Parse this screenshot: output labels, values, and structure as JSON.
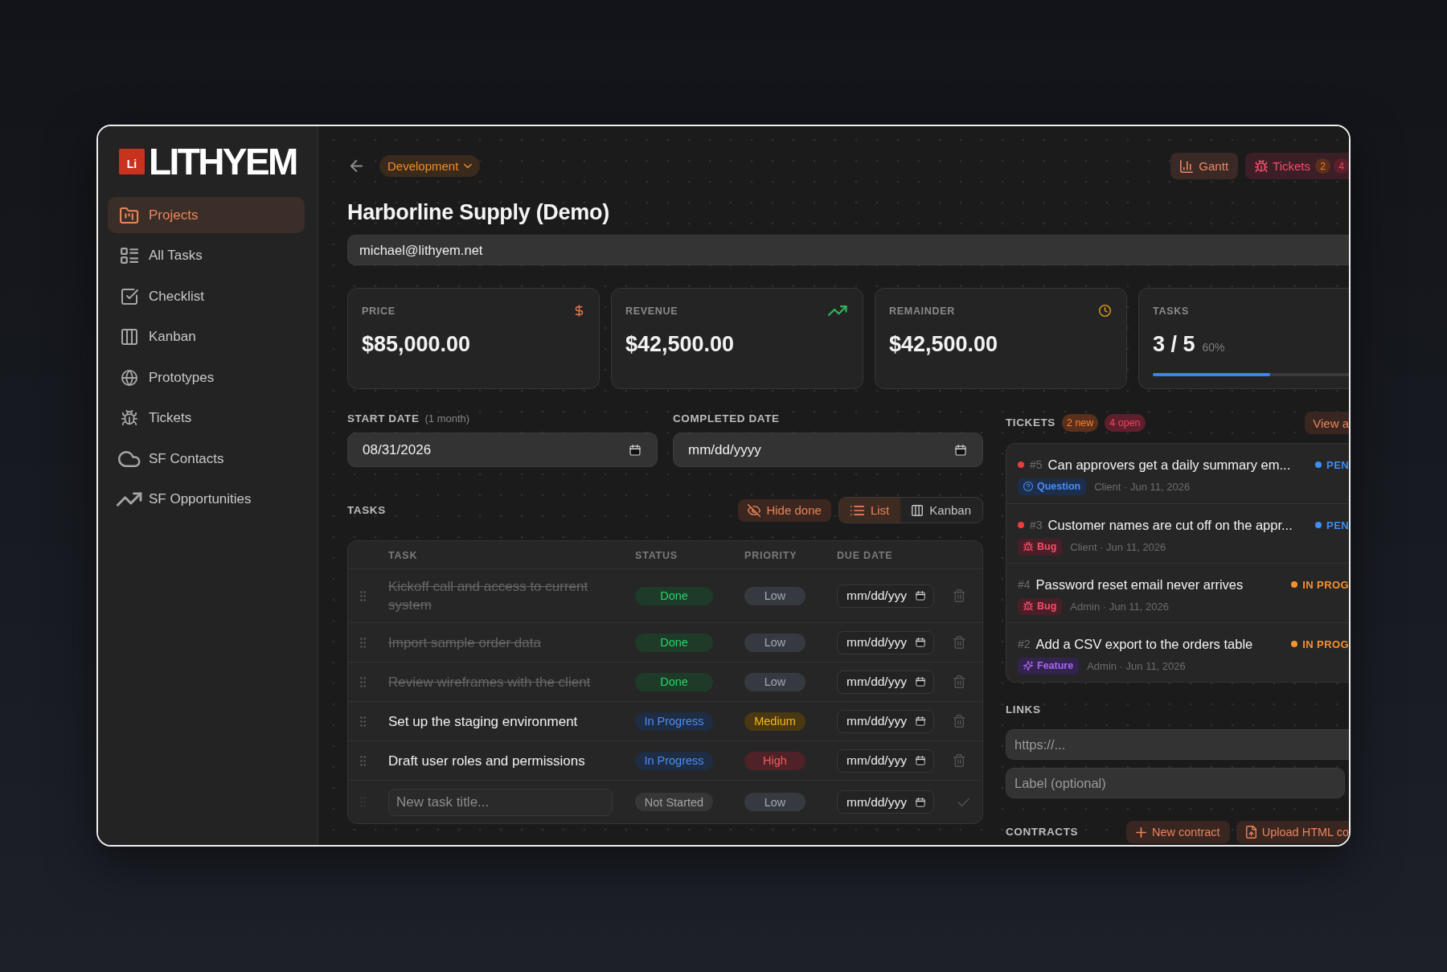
{
  "sidebar": {
    "logo": {
      "mark": "Li",
      "name": "LITHYEM"
    },
    "items": [
      {
        "label": "Projects",
        "selected": true
      },
      {
        "label": "All Tasks",
        "selected": false
      },
      {
        "label": "Checklist",
        "selected": false
      },
      {
        "label": "Kanban",
        "selected": false
      },
      {
        "label": "Prototypes",
        "selected": false
      },
      {
        "label": "Tickets",
        "selected": false
      },
      {
        "label": "SF Contacts",
        "selected": false
      },
      {
        "label": "SF Opportunities",
        "selected": false
      }
    ]
  },
  "header": {
    "stage": "Development",
    "buttons": [
      {
        "kind": "gantt",
        "label": "Gantt"
      },
      {
        "kind": "tickets",
        "label": "Tickets",
        "badges": [
          {
            "text": "2",
            "kind": "new"
          },
          {
            "text": "4",
            "kind": "open"
          }
        ]
      }
    ]
  },
  "project": {
    "title": "Harborline Supply (Demo)",
    "email": {
      "value": "michael@lithyem.net"
    }
  },
  "stats": [
    {
      "kind": "amount",
      "label": "PRICE",
      "value": "$85,000.00"
    },
    {
      "kind": "amount",
      "label": "REVENUE",
      "value": "$42,500.00"
    },
    {
      "kind": "amount",
      "label": "REMAINDER",
      "value": "$42,500.00"
    },
    {
      "kind": "progress",
      "label": "TASKS",
      "value": "3 / 5",
      "note": "60%",
      "level": 0.6
    }
  ],
  "dates": [
    {
      "label": "START DATE",
      "note": "(1 month)",
      "value": "08/31/2026"
    },
    {
      "label": "COMPLETED DATE",
      "placeholder": "mm/dd/yyyy"
    }
  ],
  "tasks": {
    "title": "TASKS",
    "hide_done": "Hide done",
    "views": [
      {
        "label": "List",
        "selected": true
      },
      {
        "label": "Kanban",
        "selected": false
      }
    ],
    "columns": [
      "TASK",
      "STATUS",
      "PRIORITY",
      "DUE DATE"
    ],
    "rows": [
      {
        "title": "Kickoff call and access to current system",
        "done": true,
        "status": {
          "label": "Done",
          "kind": "done"
        },
        "priority": {
          "label": "Low",
          "kind": "low"
        },
        "due_placeholder": "mm/dd/yyy"
      },
      {
        "title": "Import sample order data",
        "done": true,
        "status": {
          "label": "Done",
          "kind": "done"
        },
        "priority": {
          "label": "Low",
          "kind": "low"
        },
        "due_placeholder": "mm/dd/yyy"
      },
      {
        "title": "Review wireframes with the client",
        "done": true,
        "status": {
          "label": "Done",
          "kind": "done"
        },
        "priority": {
          "label": "Low",
          "kind": "low"
        },
        "due_placeholder": "mm/dd/yyy"
      },
      {
        "title": "Set up the staging environment",
        "done": false,
        "status": {
          "label": "In Progress",
          "kind": "in_progress"
        },
        "priority": {
          "label": "Medium",
          "kind": "medium"
        },
        "due_placeholder": "mm/dd/yyy"
      },
      {
        "title": "Draft user roles and permissions",
        "done": false,
        "status": {
          "label": "In Progress",
          "kind": "in_progress"
        },
        "priority": {
          "label": "High",
          "kind": "high"
        },
        "due_placeholder": "mm/dd/yyy"
      }
    ],
    "new_task": {
      "placeholder": "New task title...",
      "status": {
        "label": "Not Started",
        "kind": "not_started"
      },
      "priority": {
        "label": "Low",
        "kind": "low"
      },
      "due_placeholder": "mm/dd/yyy"
    }
  },
  "tickets": {
    "title": "TICKETS",
    "badges": [
      {
        "text": "2 new",
        "kind": "new"
      },
      {
        "text": "4 open",
        "kind": "open"
      }
    ],
    "view_all": "View a",
    "items": [
      {
        "new": true,
        "number": "#5",
        "title": "Can approvers get a daily summary em...",
        "status": {
          "label": "PEN",
          "color": "#3f8ef2"
        },
        "type": {
          "kind": "question",
          "label": "Question"
        },
        "meta": "Client · Jun 11, 2026"
      },
      {
        "new": true,
        "number": "#3",
        "title": "Customer names are cut off on the appr...",
        "status": {
          "label": "PEN",
          "color": "#3f8ef2"
        },
        "type": {
          "kind": "bug",
          "label": "Bug"
        },
        "meta": "Client · Jun 11, 2026"
      },
      {
        "new": false,
        "number": "#4",
        "title": "Password reset email never arrives",
        "status": {
          "label": "IN PROG",
          "color": "#f59331"
        },
        "type": {
          "kind": "bug",
          "label": "Bug"
        },
        "meta": "Admin · Jun 11, 2026"
      },
      {
        "new": false,
        "number": "#2",
        "title": "Add a CSV export to the orders table",
        "status": {
          "label": "IN PROG",
          "color": "#f59331"
        },
        "type": {
          "kind": "feature",
          "label": "Feature"
        },
        "meta": "Admin · Jun 11, 2026"
      }
    ]
  },
  "links": {
    "title": "LINKS",
    "url_placeholder": "https://...",
    "label_placeholder": "Label (optional)"
  },
  "contracts": {
    "title": "CONTRACTS",
    "buttons": [
      {
        "kind": "new",
        "label": "New contract"
      },
      {
        "kind": "upload",
        "label": "Upload HTML co"
      }
    ]
  }
}
